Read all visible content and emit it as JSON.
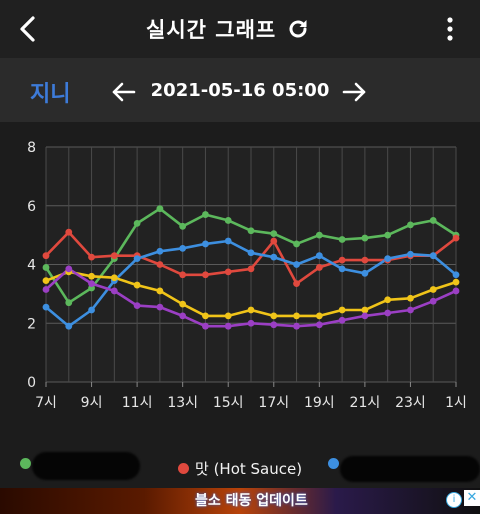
{
  "header": {
    "title": "실시간 그래프"
  },
  "icons": {
    "back": "back-arrow-icon",
    "refresh": "refresh-icon",
    "more": "more-vertical-icon",
    "prev": "arrow-left-icon",
    "next": "arrow-right-icon"
  },
  "user": {
    "name": "지니"
  },
  "date_nav": {
    "datetime": "2021-05-16 05:00"
  },
  "legend": {
    "items": [
      {
        "label": "",
        "color": "#5cb85c"
      },
      {
        "label": "맛 (Hot Sauce)",
        "color": "#e0493e"
      },
      {
        "label": "",
        "color": "#3d8fe0"
      }
    ]
  },
  "ad": {
    "text": "블소 태동 업데이트",
    "info": "i",
    "close": "✕"
  },
  "chart_data": {
    "type": "line",
    "x": [
      "7시",
      "8시",
      "9시",
      "10시",
      "11시",
      "12시",
      "13시",
      "14시",
      "15시",
      "16시",
      "17시",
      "18시",
      "19시",
      "20시",
      "21시",
      "22시",
      "23시",
      "0시",
      "1시"
    ],
    "xtick_labels": [
      "7시",
      "9시",
      "11시",
      "13시",
      "15시",
      "17시",
      "19시",
      "21시",
      "23시",
      "1시"
    ],
    "ylim": [
      0,
      8
    ],
    "yticks": [
      0,
      2,
      4,
      6,
      8
    ],
    "grid": true,
    "series": [
      {
        "color": "#5cb85c",
        "values": [
          3.9,
          2.7,
          3.2,
          4.2,
          5.4,
          5.9,
          5.3,
          5.7,
          5.5,
          5.15,
          5.05,
          4.7,
          5.0,
          4.85,
          4.9,
          5.0,
          5.35,
          5.5,
          5.0
        ]
      },
      {
        "name": "맛 (Hot Sauce)",
        "color": "#e0493e",
        "values": [
          4.3,
          5.1,
          4.25,
          4.3,
          4.3,
          4.0,
          3.65,
          3.65,
          3.75,
          3.85,
          4.8,
          3.35,
          3.9,
          4.15,
          4.15,
          4.15,
          4.3,
          4.3,
          4.9
        ]
      },
      {
        "color": "#3d8fe0",
        "values": [
          2.55,
          1.9,
          2.45,
          3.45,
          4.2,
          4.45,
          4.55,
          4.7,
          4.8,
          4.4,
          4.25,
          4.0,
          4.3,
          3.85,
          3.7,
          4.2,
          4.35,
          4.3,
          3.65
        ]
      },
      {
        "color": "#f0c419",
        "values": [
          3.45,
          3.75,
          3.6,
          3.55,
          3.3,
          3.1,
          2.65,
          2.25,
          2.25,
          2.45,
          2.25,
          2.25,
          2.25,
          2.45,
          2.45,
          2.8,
          2.85,
          3.15,
          3.4
        ]
      },
      {
        "color": "#9b3fc4",
        "values": [
          3.15,
          3.85,
          3.35,
          3.1,
          2.6,
          2.55,
          2.25,
          1.9,
          1.9,
          2.0,
          1.95,
          1.9,
          1.95,
          2.1,
          2.25,
          2.35,
          2.45,
          2.75,
          3.1
        ]
      }
    ]
  }
}
